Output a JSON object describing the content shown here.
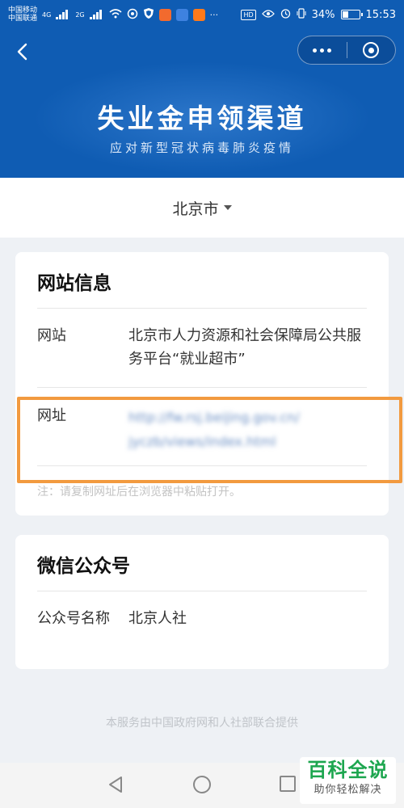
{
  "status_bar": {
    "carrier_1": "中国移动",
    "carrier_2": "中国联通",
    "net_1": "4G",
    "net_2": "2G",
    "app_icons": [
      "soul-app-icon",
      "taobao-icon"
    ],
    "hd": "HD",
    "battery": "34%",
    "battery_level": 0.34,
    "time": "15:53"
  },
  "header": {
    "title": "失业金申领渠道",
    "subtitle": "应对新型冠状病毒肺炎疫情",
    "back_icon": "back-icon",
    "more_icon": "more-icon",
    "close_icon": "target-icon"
  },
  "city": {
    "selected": "北京市",
    "icon": "caret-down-icon"
  },
  "website_card": {
    "title": "网站信息",
    "site_label": "网站",
    "site_value": "北京市人力资源和社会保障局公共服务平台“就业超市”",
    "url_label": "网址",
    "url_line_1": "http://fw.rsj.beijing.gov.cn/",
    "url_line_2": "jyczb/views/index.html",
    "note": "注：请复制网址后在浏览器中粘贴打开。"
  },
  "wechat_card": {
    "title": "微信公众号",
    "name_label": "公众号名称",
    "name_value": "北京人社"
  },
  "footer": {
    "text": "本服务由中国政府网和人社部联合提供"
  },
  "nav": {
    "back_icon": "triangle-back-icon",
    "home_icon": "circle-home-icon",
    "recent_icon": "square-recent-icon"
  },
  "watermark": {
    "main": "百科全说",
    "sub": "助你轻松解决"
  },
  "colors": {
    "header_blue": "#0f5cb3",
    "highlight_orange": "#f29a3f",
    "watermark_green": "#1da64f"
  }
}
